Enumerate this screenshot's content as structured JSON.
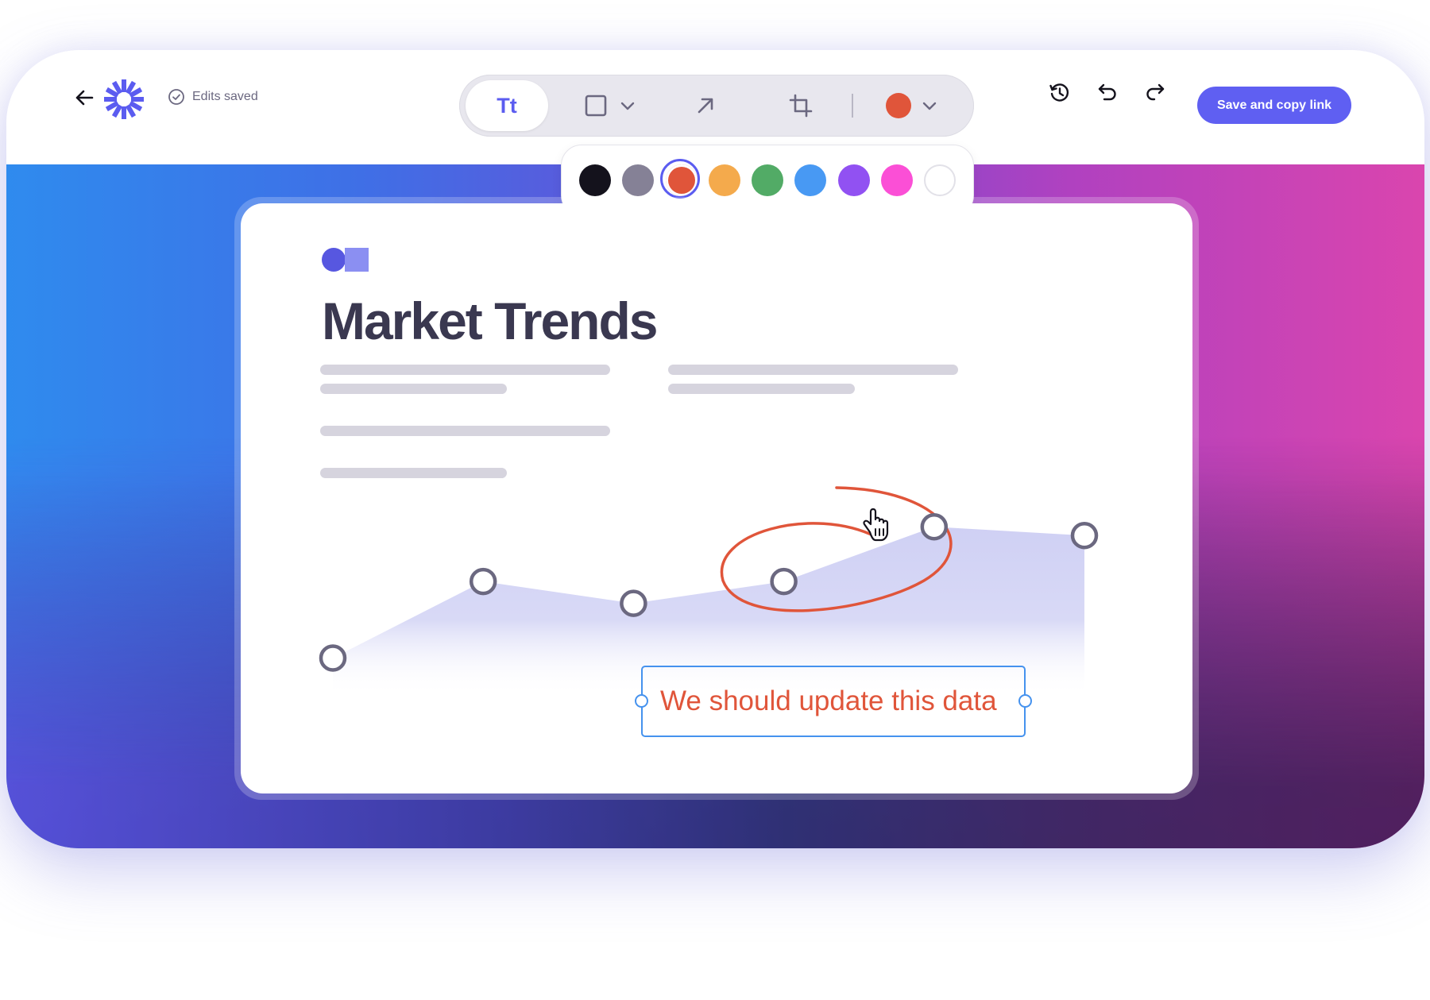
{
  "header": {
    "back_label": "Back",
    "status_text": "Edits saved",
    "save_button_label": "Save and copy link"
  },
  "toolbar": {
    "text_tool_label": "Tt",
    "tools": [
      "text-tool",
      "rectangle-tool",
      "arrow-tool",
      "crop-tool",
      "color-picker"
    ],
    "selected_tool": "text-tool",
    "current_color": "#e0553a"
  },
  "palette": {
    "colors": [
      "#14121c",
      "#858196",
      "#e0553a",
      "#f4aa4c",
      "#52ab66",
      "#4899f3",
      "#9151f2",
      "#fb4fd6",
      "#ffffff"
    ],
    "selected_index": 2
  },
  "document": {
    "title": "Market Trends",
    "annotation_text": "We should update this data"
  },
  "chart_data": {
    "type": "area",
    "title": "",
    "xlabel": "",
    "ylabel": "",
    "x": [
      1,
      2,
      3,
      4,
      5,
      6
    ],
    "values": [
      10,
      45,
      35,
      45,
      70,
      66
    ],
    "ylim": [
      0,
      100
    ],
    "grid": false,
    "highlighted_point_index": 3,
    "fill_color": "#cfd0f4",
    "marker_color": "#6b6880"
  }
}
